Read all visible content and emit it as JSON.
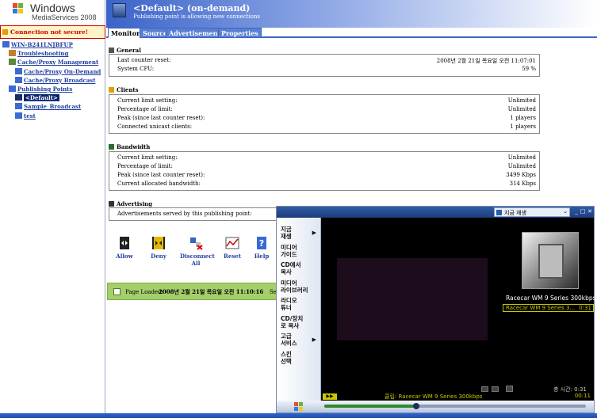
{
  "logo": {
    "line1": "Windows",
    "line2": "MediaServices 2008"
  },
  "warning": "Connection not secure!",
  "tree": [
    {
      "label": "WIN-B241LNJBFUP",
      "indent": 0,
      "selected": false
    },
    {
      "label": "Troubleshooting",
      "indent": 1,
      "selected": false
    },
    {
      "label": "Cache/Proxy Management",
      "indent": 1,
      "selected": false
    },
    {
      "label": "Cache/Proxy On-Demand",
      "indent": 2,
      "selected": false
    },
    {
      "label": "Cache/Proxy Broadcast",
      "indent": 2,
      "selected": false
    },
    {
      "label": "Publishing Points",
      "indent": 1,
      "selected": false
    },
    {
      "label": "<Default>",
      "indent": 2,
      "selected": true
    },
    {
      "label": "Sample_Broadcast",
      "indent": 2,
      "selected": false
    },
    {
      "label": "test",
      "indent": 2,
      "selected": false
    }
  ],
  "header": {
    "title": "<Default>  (on-demand)",
    "subtitle": "Publishing point is allowing new connections"
  },
  "tabs": [
    "Monitor",
    "Source",
    "Advertisement",
    "Properties"
  ],
  "sections": {
    "general": {
      "title": "General",
      "rows": [
        {
          "label": "Last counter reset:",
          "value": "2008년 2월 21일 목요일 오전 11:07:01"
        },
        {
          "label": "System CPU:",
          "value": "59 %"
        }
      ]
    },
    "clients": {
      "title": "Clients",
      "rows": [
        {
          "label": "Current limit setting:",
          "value": "Unlimited"
        },
        {
          "label": "Percentage of limit:",
          "value": "Unlimited"
        },
        {
          "label": "Peak (since last counter reset):",
          "value": "1 players"
        },
        {
          "label": "Connected unicast clients:",
          "value": "1 players"
        }
      ]
    },
    "bandwidth": {
      "title": "Bandwidth",
      "rows": [
        {
          "label": "Current limit setting:",
          "value": "Unlimited"
        },
        {
          "label": "Percentage of limit:",
          "value": "Unlimited"
        },
        {
          "label": "Peak (since last counter reset):",
          "value": "3499 Kbps"
        },
        {
          "label": "Current allocated bandwidth:",
          "value": "314 Kbps"
        }
      ]
    },
    "advertising": {
      "title": "Advertising",
      "rows": [
        {
          "label": "Advertisements served by this publishing point:",
          "value": ""
        }
      ]
    }
  },
  "toolbar": {
    "allow": "Allow",
    "deny": "Deny",
    "disconnect_line1": "Disconnect",
    "disconnect_line2": "All",
    "reset": "Reset",
    "help": "Help"
  },
  "status": {
    "label": "Page Loaded:",
    "value": "2008년 2월 21일 목요일 오전 11:10:16",
    "extra": "Sel"
  },
  "player": {
    "now_playing_button": "지금 재생",
    "nav": [
      {
        "line1": "지금",
        "line2": "재생",
        "arrow": true
      },
      {
        "line1": "미디어",
        "line2": "가이드",
        "arrow": false
      },
      {
        "line1": "CD에서",
        "line2": "복사",
        "arrow": false
      },
      {
        "line1": "미디어",
        "line2": "라이브러리",
        "arrow": false
      },
      {
        "line1": "라디오",
        "line2": "튜너",
        "arrow": false
      },
      {
        "line1": "CD/장치",
        "line2": "로 복사",
        "arrow": false
      },
      {
        "line1": "고급",
        "line2": "서비스",
        "arrow": true
      },
      {
        "line1": "스킨",
        "line2": "선택",
        "arrow": false
      }
    ],
    "playlist_title": "Racecar WM 9 Series 300kbps",
    "playlist_item": "Racecar WM 9 Series 3...",
    "playlist_item_duration": "0:31",
    "total_time": "총 시간: 0:31",
    "clip_text": "클립: Racecar WM 9 Series 300kbps",
    "elapsed": "00:11",
    "progress": 0.35
  }
}
